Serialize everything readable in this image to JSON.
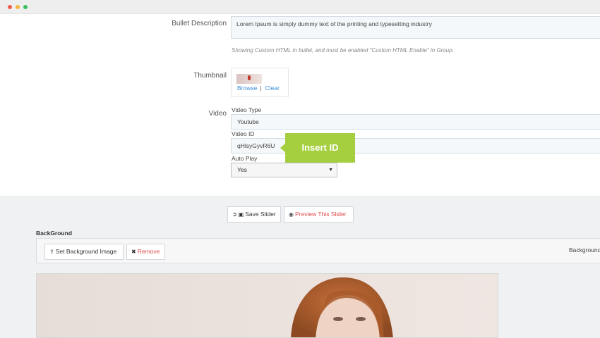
{
  "window": {
    "dots": [
      "#f25b4b",
      "#f5b63c",
      "#3bc15c"
    ]
  },
  "form": {
    "bullet_description": {
      "label": "Bullet Description",
      "value": "Lorem Ipsum is simply dummy text of the printing and typesetting industry",
      "hint": "Showing Custom HTML in bullet, and must be enabled \"Custom HTML Enable\" in Group."
    },
    "thumbnail": {
      "label": "Thumbnail",
      "browse": "Browse",
      "separator": "|",
      "clear": "Clear"
    },
    "video": {
      "label": "Video",
      "type_label": "Video Type",
      "type_value": "Youtube",
      "id_label": "Video ID",
      "id_value": "qHlsyGyvR6U",
      "autoplay_label": "Auto Play",
      "autoplay_value": "Yes"
    },
    "tooltip": "Insert ID"
  },
  "toolbar": {
    "save": "Save Slider",
    "preview": "Preview This Slider"
  },
  "background": {
    "title": "BackGround",
    "set_image": "Set Background Image",
    "remove": "Remove",
    "right_label": "Background"
  },
  "colors": {
    "accent_green": "#a6cf3f",
    "link_blue": "#3a8fd6",
    "danger_red": "#e04c4c"
  }
}
